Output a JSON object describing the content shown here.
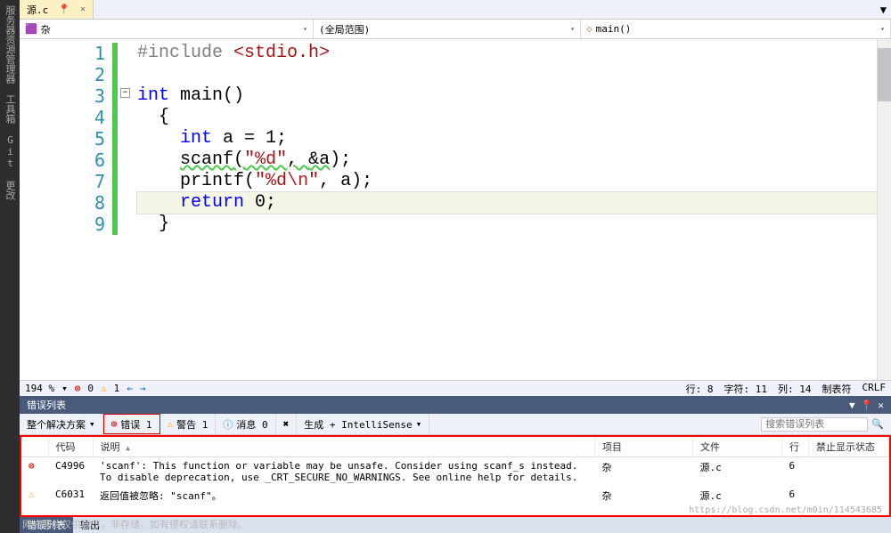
{
  "sidebar": {
    "tabs": [
      "服务器资源管理器",
      "工具箱",
      "Git 更改"
    ]
  },
  "file_tab": {
    "name": "源.c",
    "close": "✕",
    "pin": "📌"
  },
  "nav": {
    "scope1": "杂",
    "scope2": "(全局范围)",
    "scope3": "main()"
  },
  "code": {
    "lines": [
      "1",
      "2",
      "3",
      "4",
      "5",
      "6",
      "7",
      "8",
      "9"
    ],
    "include_pre": "#include ",
    "include_hdr": "<stdio.h>",
    "int_kw": "int",
    "main_name": " main()",
    "brace_open": "{",
    "decl_kw": "int",
    "decl_rest": " a = 1;",
    "scanf_name": "scanf",
    "scanf_open": "(",
    "scanf_fmt": "\"%d\"",
    "scanf_mid": ", ",
    "scanf_arg": "&a",
    "scanf_close": ");",
    "printf_name": "printf(",
    "printf_fmt1": "\"%d",
    "printf_esc": "\\n",
    "printf_fmt2": "\"",
    "printf_rest": ", a);",
    "return_kw": "return",
    "return_val": " 0;",
    "brace_close": "}",
    "collapse": "−"
  },
  "status": {
    "zoom": "194 %",
    "err_count": "0",
    "warn_count": "1",
    "pos_line": "行: 8",
    "pos_char": "字符: 11",
    "pos_col": "列: 14",
    "tab_mode": "制表符",
    "line_end": "CRLF"
  },
  "error_panel": {
    "title": "错误列表",
    "scope": "整个解决方案",
    "err_btn": "错误 1",
    "warn_btn": "警告 1",
    "msg_btn": "消息 0",
    "build_filter": "生成 + IntelliSense",
    "search_placeholder": "搜索错误列表",
    "cols": {
      "code": "代码",
      "desc": "说明",
      "project": "项目",
      "file": "文件",
      "line": "行",
      "suppress": "禁止显示状态"
    },
    "rows": [
      {
        "type": "error",
        "code": "C4996",
        "desc": "'scanf': This function or variable may be unsafe. Consider using scanf_s instead. To disable deprecation, use _CRT_SECURE_NO_WARNINGS. See online help for details.",
        "project": "杂",
        "file": "源.c",
        "line": "6"
      },
      {
        "type": "warn",
        "code": "C6031",
        "desc": "返回值被忽略: \"scanf\"。",
        "project": "杂",
        "file": "源.c",
        "line": "6"
      }
    ]
  },
  "bottom_tabs": {
    "active": "错误列表",
    "other": "输出"
  },
  "watermark": "网络图片仅供展示，非存储，如有侵权请联系删除。",
  "watermark2": "https://blog.csdn.net/m0in/114543685"
}
